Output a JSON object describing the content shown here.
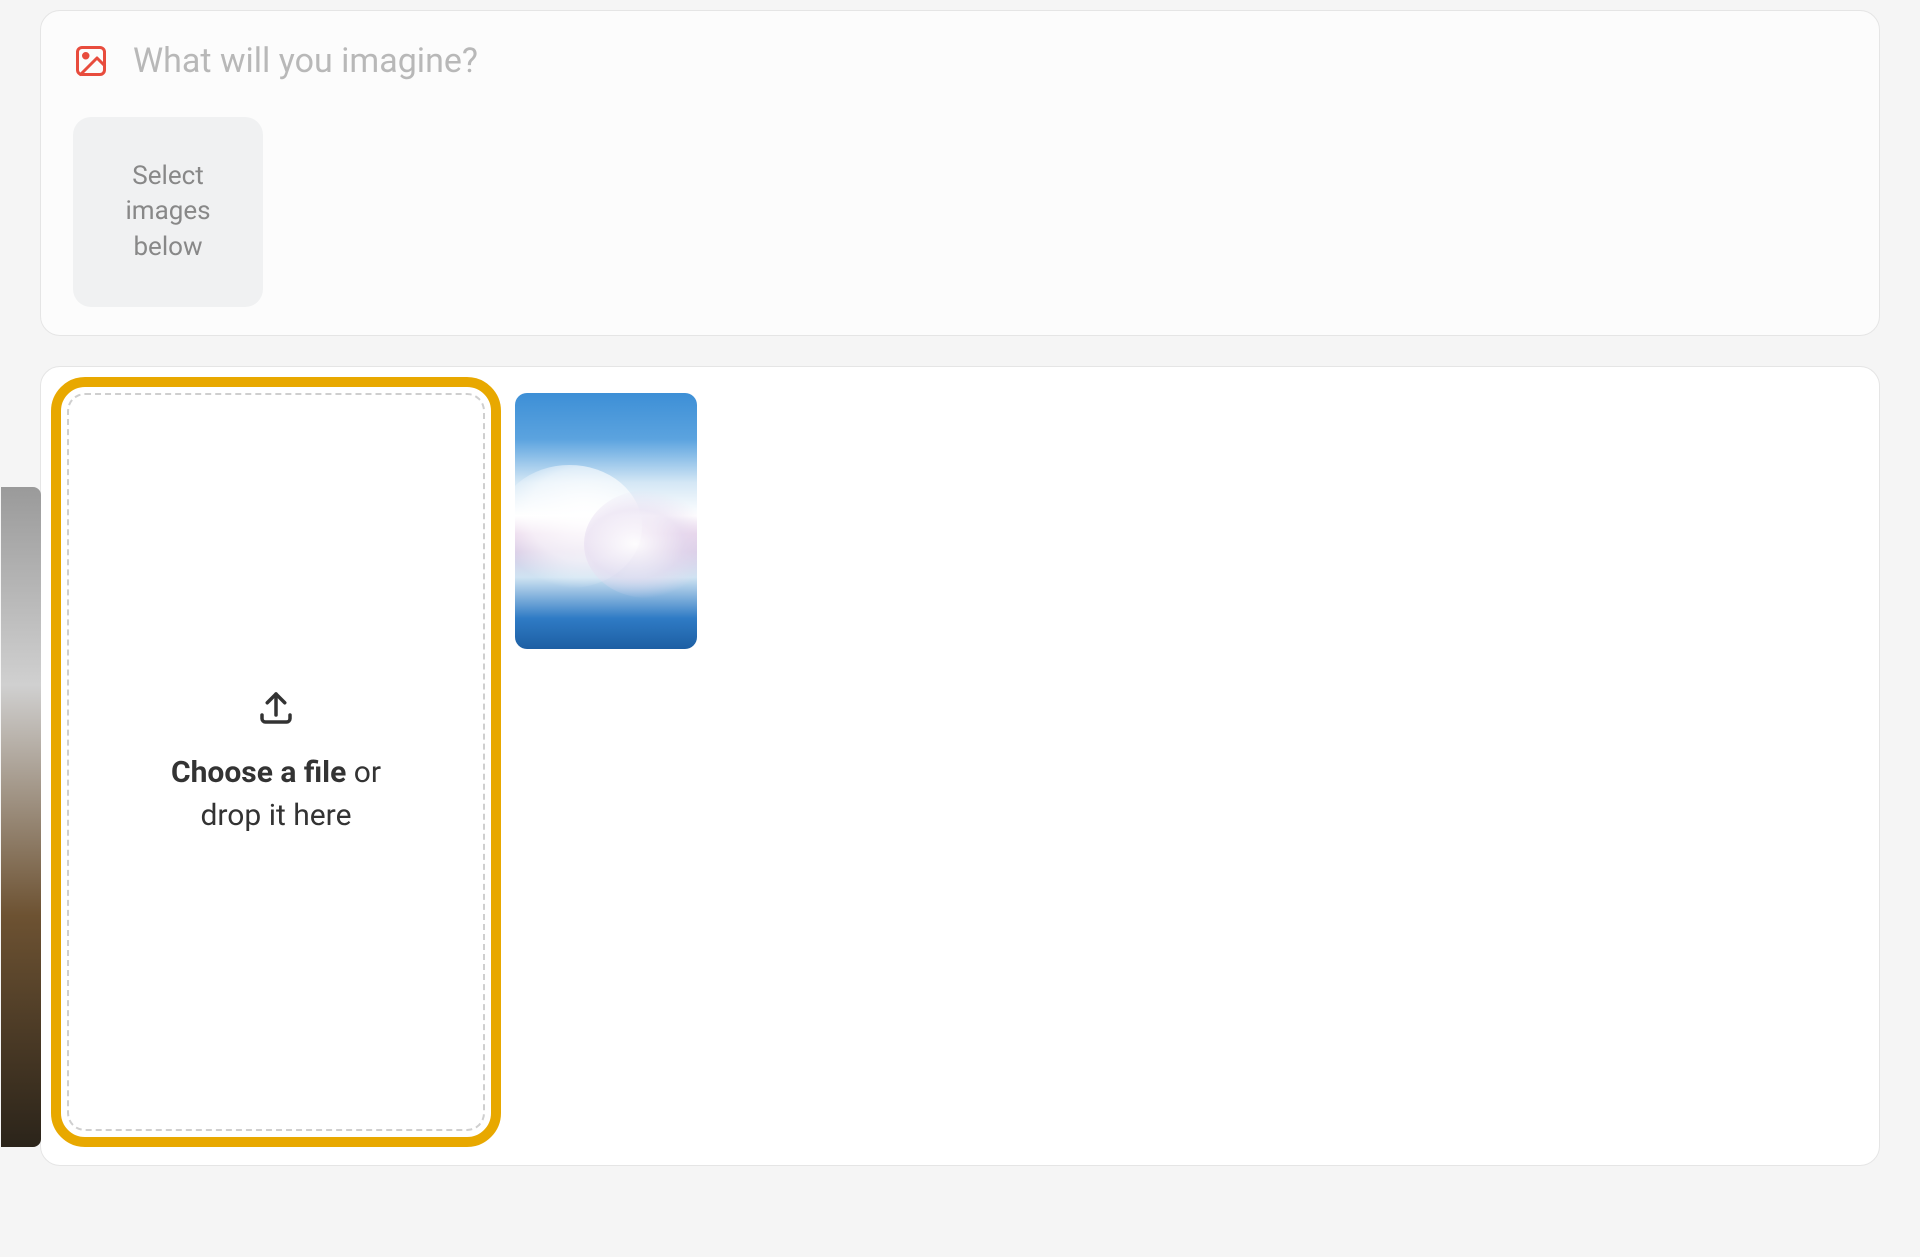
{
  "prompt": {
    "placeholder": "What will you imagine?",
    "value": "",
    "icon": "image-icon"
  },
  "select_chip": {
    "line1": "Select",
    "line2": "images",
    "line3": "below"
  },
  "dropzone": {
    "bold_text": "Choose a file",
    "rest_text_1": " or",
    "rest_text_2": "drop it here",
    "icon": "upload-icon",
    "highlight_color": "#e8a800"
  },
  "thumbnails": [
    {
      "name": "sky-clouds-thumbnail"
    }
  ]
}
